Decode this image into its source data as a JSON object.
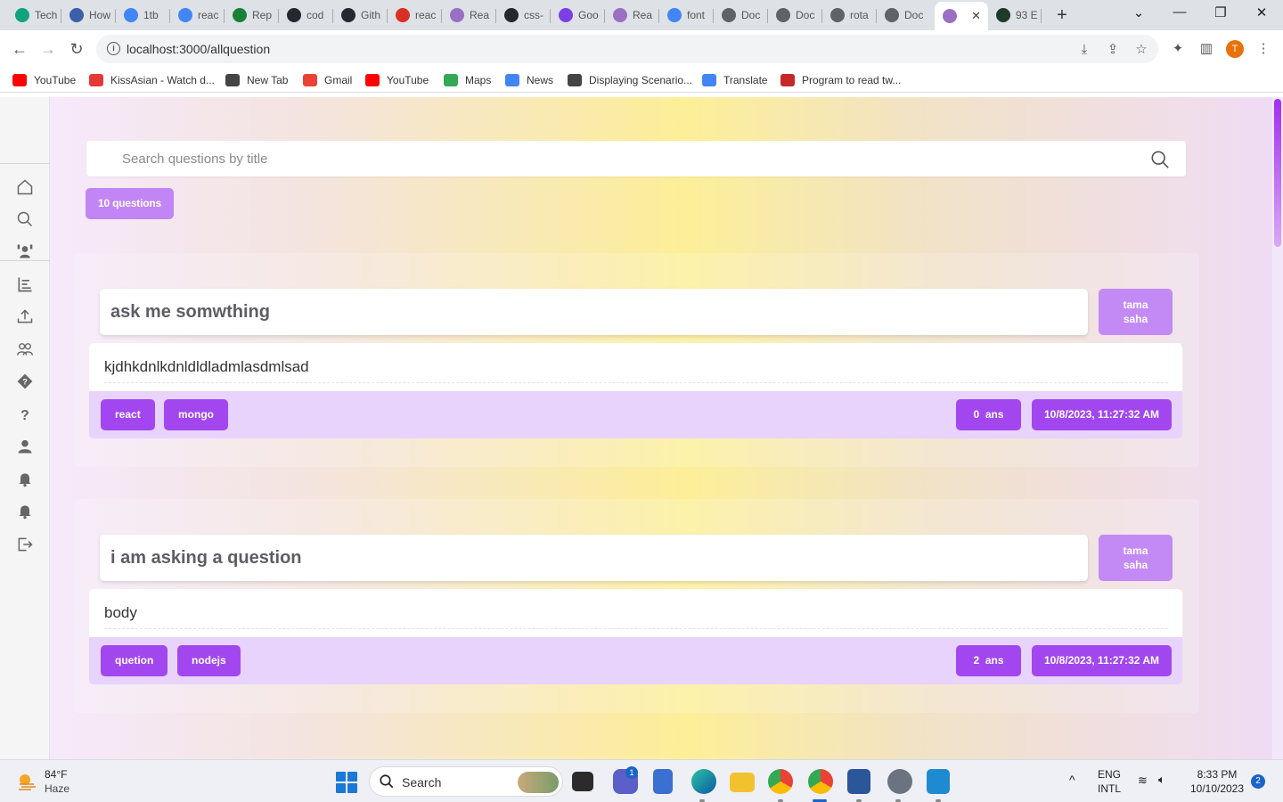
{
  "browser": {
    "tabs": [
      {
        "label": "Tech",
        "color": "#10a37f"
      },
      {
        "label": "How",
        "color": "#3b5fa8"
      },
      {
        "label": "1tb",
        "color": "#4285f4"
      },
      {
        "label": "reac",
        "color": "#4285f4"
      },
      {
        "label": "Rep",
        "color": "#188038"
      },
      {
        "label": "cod",
        "color": "#24292f"
      },
      {
        "label": "Gith",
        "color": "#24292f"
      },
      {
        "label": "reac",
        "color": "#d93025"
      },
      {
        "label": "Rea",
        "color": "#9a6fc4"
      },
      {
        "label": "css-",
        "color": "#24292f"
      },
      {
        "label": "Goo",
        "color": "#7b3fe4"
      },
      {
        "label": "Rea",
        "color": "#9a6fc4"
      },
      {
        "label": "font",
        "color": "#4285f4"
      },
      {
        "label": "Doc",
        "color": "#5f6368"
      },
      {
        "label": "Doc",
        "color": "#5f6368"
      },
      {
        "label": "rota",
        "color": "#5f6368"
      },
      {
        "label": "Doc",
        "color": "#5f6368"
      },
      {
        "label": "",
        "color": "#9a6fc4"
      },
      {
        "label": "93 E",
        "color": "#1e3a2a"
      }
    ],
    "url": "localhost:3000/allquestion",
    "profile_initial": "T",
    "bookmarks": [
      {
        "label": "YouTube",
        "color": "#ff0000"
      },
      {
        "label": "KissAsian - Watch d...",
        "color": "#e53935"
      },
      {
        "label": "New Tab",
        "color": "#444444"
      },
      {
        "label": "Gmail",
        "color": "#ea4335"
      },
      {
        "label": "YouTube",
        "color": "#ff0000"
      },
      {
        "label": "Maps",
        "color": "#34a853"
      },
      {
        "label": "News",
        "color": "#4285f4"
      },
      {
        "label": "Displaying Scenario...",
        "color": "#444444"
      },
      {
        "label": "Translate",
        "color": "#4285f4"
      },
      {
        "label": "Program to read tw...",
        "color": "#c62828"
      }
    ]
  },
  "sidebar": {
    "items": [
      {
        "icon": "home-icon"
      },
      {
        "icon": "search-icon"
      },
      {
        "icon": "team-icon"
      },
      {
        "icon": "list-icon"
      },
      {
        "icon": "upload-icon"
      },
      {
        "icon": "users-icon"
      },
      {
        "icon": "question-diamond-icon"
      },
      {
        "icon": "question-mark-icon"
      },
      {
        "icon": "user-icon"
      },
      {
        "icon": "bell-icon"
      },
      {
        "icon": "bell-icon"
      },
      {
        "icon": "logout-icon"
      }
    ]
  },
  "main": {
    "search_placeholder": "Search questions by title",
    "question_count": "10 questions",
    "questions": [
      {
        "title": "ask me somwthing",
        "author_first": "tama",
        "author_last": "saha",
        "body": "kjdhkdnlkdnldldladmlasdmlsad",
        "tags": [
          "react",
          "mongo"
        ],
        "answers_count": "0",
        "answers_label": "ans",
        "date": "10/8/2023, 11:27:32 AM"
      },
      {
        "title": "i am asking a question",
        "author_first": "tama",
        "author_last": "saha",
        "body": "body",
        "tags": [
          "quetion",
          "nodejs"
        ],
        "answers_count": "2",
        "answers_label": "ans",
        "date": "10/8/2023, 11:27:32 AM"
      }
    ]
  },
  "taskbar": {
    "weather_temp": "84°F",
    "weather_desc": "Haze",
    "search_label": "Search",
    "teams_badge": "1",
    "lang_top": "ENG",
    "lang_bottom": "INTL",
    "time": "8:33 PM",
    "date": "10/10/2023",
    "notification_count": "2"
  },
  "colors": {
    "accent": "#a247ef",
    "author_badge": "#c38af6",
    "count_badge": "#c185f5",
    "footer_bg": "#e7d3fb"
  }
}
